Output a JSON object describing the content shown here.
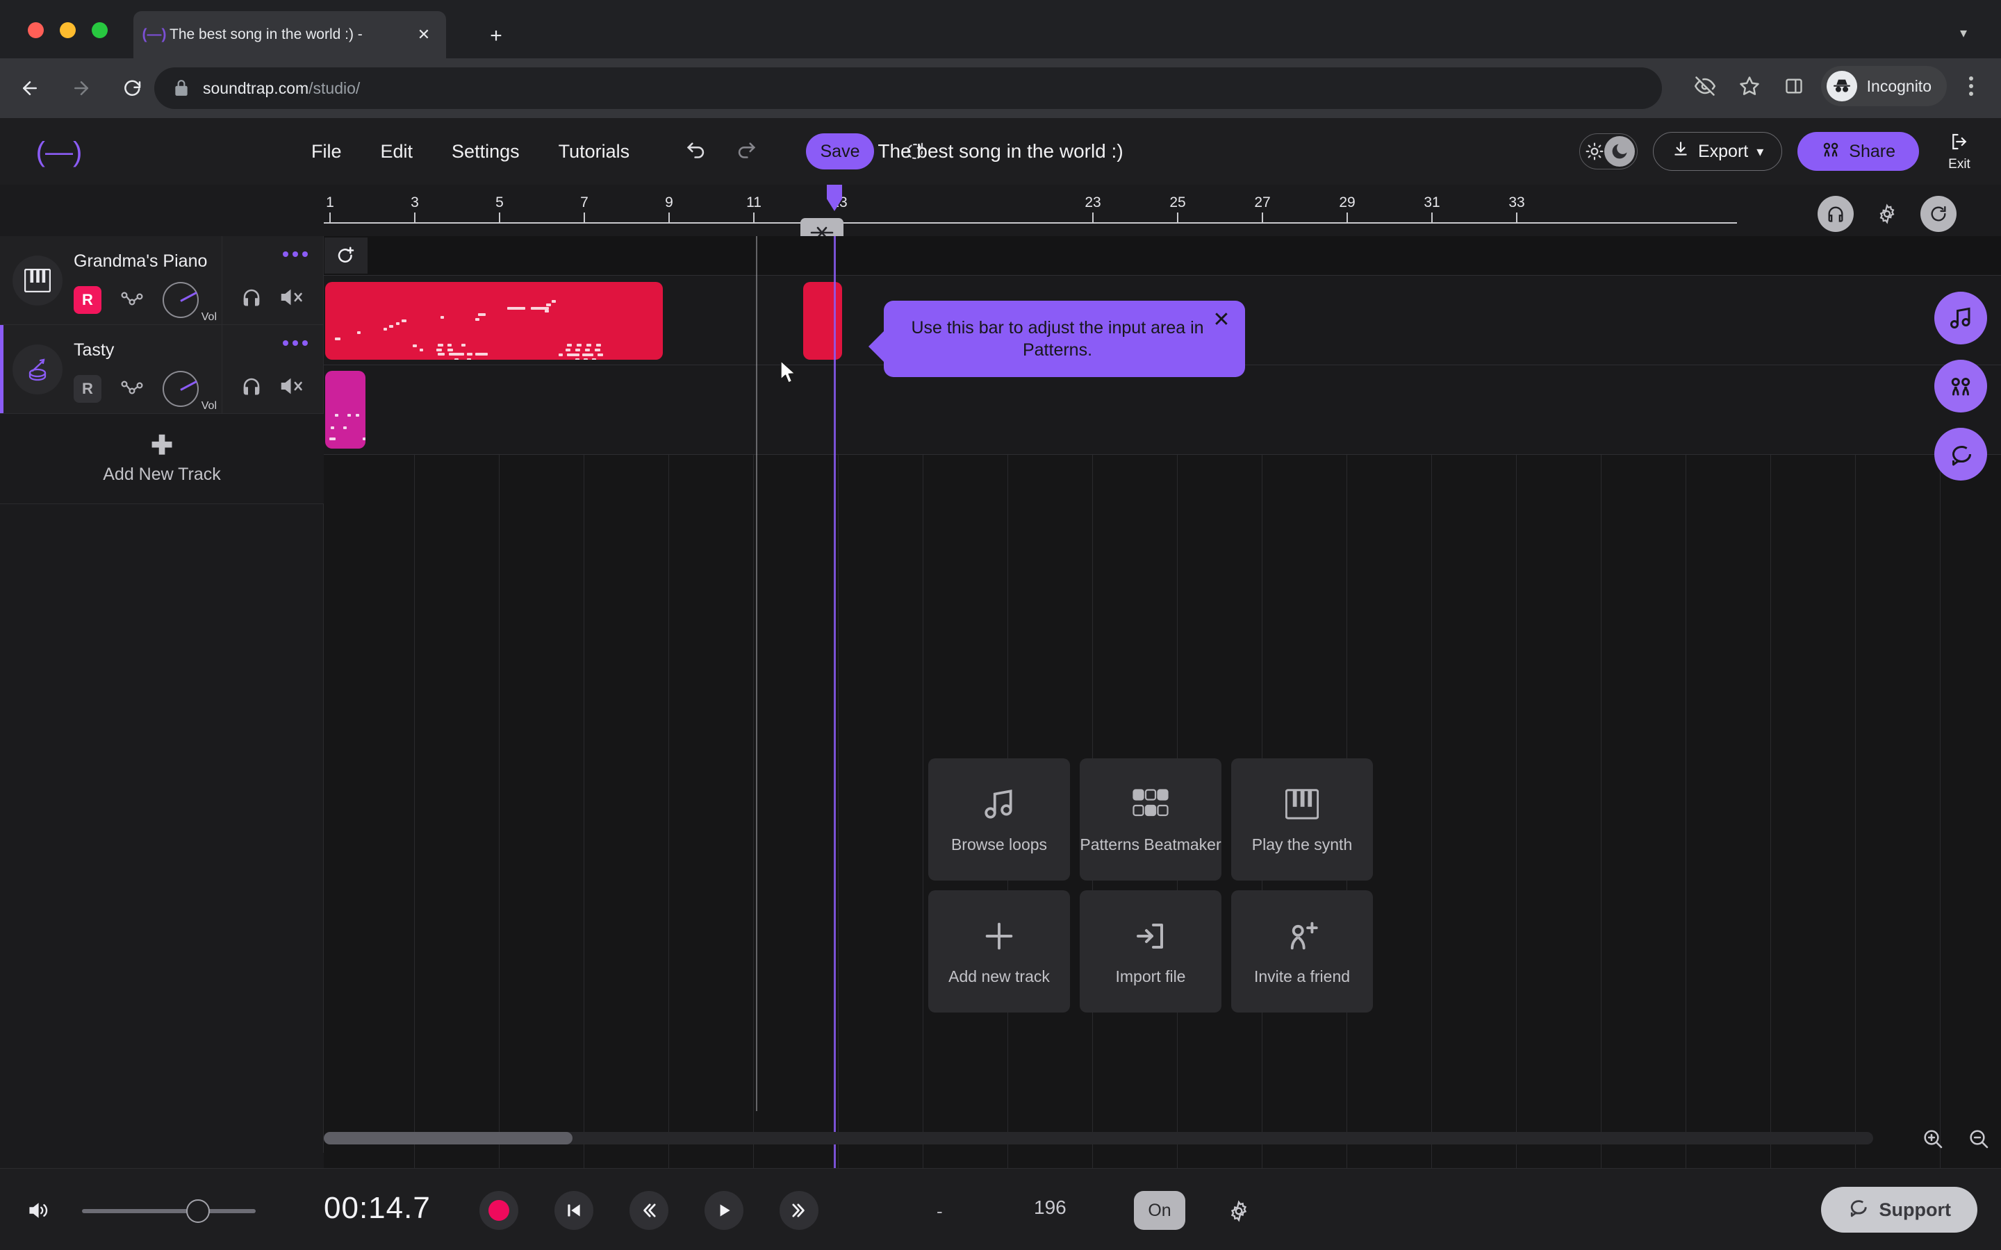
{
  "browser": {
    "tab": {
      "title": "The best song in the world :) -",
      "favicon_icon": "soundtrap-logo-icon",
      "close_icon": "close-icon"
    },
    "new_tab_icon": "plus-icon",
    "tabstrip_chevron_icon": "chevron-down-icon",
    "nav": {
      "back_icon": "back-arrow-icon",
      "forward_icon": "forward-arrow-icon",
      "reload_icon": "reload-icon"
    },
    "omnibox": {
      "lock_icon": "lock-icon",
      "domain": "soundtrap.com",
      "path": "/studio/"
    },
    "toolbar_right": {
      "tracking_icon": "eye-slash-icon",
      "bookmark_icon": "star-icon",
      "side_panel_icon": "side-panel-icon",
      "profile_label": "Incognito",
      "profile_icon": "incognito-icon",
      "menu_icon": "kebab-menu-icon"
    }
  },
  "app": {
    "logo_icon": "soundtrap-logo-icon",
    "menus": [
      "File",
      "Edit",
      "Settings",
      "Tutorials"
    ],
    "undo_icon": "undo-icon",
    "redo_icon": "redo-icon",
    "save_label": "Save",
    "revert_icon": "revert-icon",
    "project_title": "The best song in the world :)",
    "theme": {
      "sun_icon": "sun-icon",
      "moon_icon": "moon-icon"
    },
    "export_label": "Export",
    "export_icon": "download-icon",
    "export_caret": "⌄",
    "share_label": "Share",
    "share_icon": "people-icon",
    "exit_label": "Exit",
    "exit_icon": "exit-icon",
    "accent_color": "#8b5cf6"
  },
  "ruler": {
    "bars": [
      1,
      3,
      5,
      7,
      9,
      11,
      13,
      23,
      25,
      27,
      29,
      31,
      33
    ],
    "playhead_bar_label": "13",
    "loop_chip_icon": "loop-snap-icon",
    "right_icons": [
      "headphone-icon",
      "gear-icon",
      "loop-icon"
    ]
  },
  "coach_tooltip": {
    "text": "Use this bar to adjust the input area in Patterns.",
    "close_icon": "close-icon",
    "color": "#8b5cf6"
  },
  "tracks": [
    {
      "name": "Grandma's Piano",
      "instrument_icon": "piano-icon",
      "record_label": "R",
      "record_armed": true,
      "automation_icon": "automation-icon",
      "volume_label": "Vol",
      "solo_icon": "headphone-icon",
      "mute_icon": "speaker-mute-icon",
      "more_icon": "more-dots-icon",
      "selected": false,
      "clip_color": "#e0143f"
    },
    {
      "name": "Tasty",
      "instrument_icon": "drum-icon",
      "record_label": "R",
      "record_armed": false,
      "automation_icon": "automation-icon",
      "volume_label": "Vol",
      "solo_icon": "headphone-icon",
      "mute_icon": "speaker-mute-icon",
      "more_icon": "more-dots-icon",
      "selected": true,
      "clip_color": "#cc219b"
    }
  ],
  "add_track": {
    "label": "Add New Track",
    "icon": "plus-icon"
  },
  "quick_actions": [
    {
      "label": "Browse\nloops",
      "icon": "music-note-icon"
    },
    {
      "label": "Patterns\nBeatmaker",
      "icon": "patterns-grid-icon"
    },
    {
      "label": "Play the\nsynth",
      "icon": "piano-icon"
    },
    {
      "label": "Add new\ntrack",
      "icon": "plus-icon"
    },
    {
      "label": "Import file",
      "icon": "import-icon"
    },
    {
      "label": "Invite a\nfriend",
      "icon": "person-add-icon"
    }
  ],
  "fabs": [
    {
      "icon": "music-note-icon",
      "name": "loops-fab"
    },
    {
      "icon": "people-icon",
      "name": "collaborate-fab"
    },
    {
      "icon": "chat-icon",
      "name": "chat-fab"
    }
  ],
  "timeline_controls": {
    "scrollbar_icon": "horizontal-scrollbar",
    "zoom_in_icon": "zoom-in-icon",
    "zoom_out_icon": "zoom-out-icon"
  },
  "transport": {
    "volume_icon": "speaker-icon",
    "time": "00:14.7",
    "record_icon": "record-icon",
    "to_start_icon": "skip-to-start-icon",
    "rewind_icon": "rewind-icon",
    "play_icon": "play-icon",
    "forward_icon": "fast-forward-icon",
    "key_value": "-",
    "bpm_value": "196",
    "metronome_label": "On",
    "metronome_gear_icon": "gear-icon"
  },
  "support": {
    "label": "Support",
    "icon": "chat-bubble-icon"
  }
}
